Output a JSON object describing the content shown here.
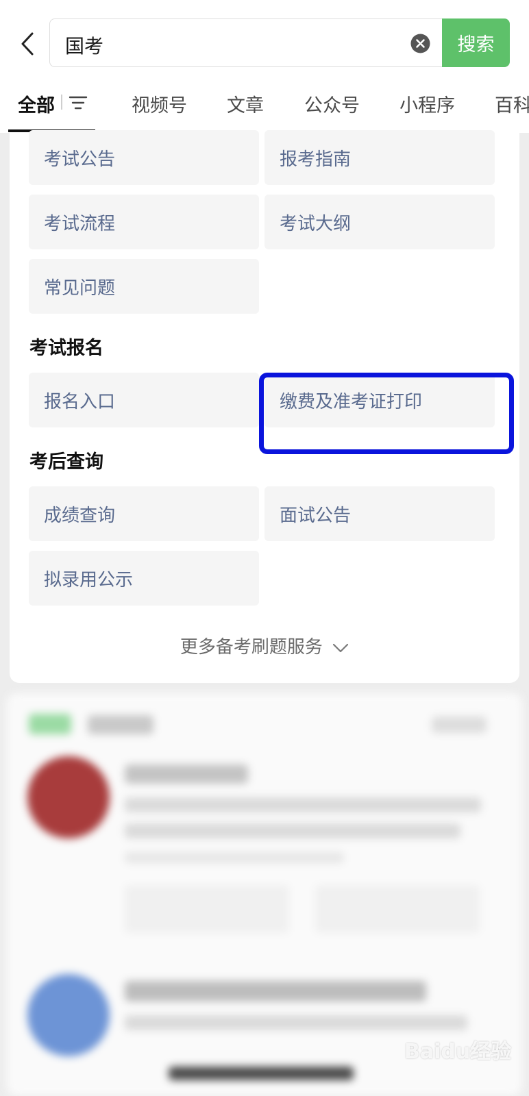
{
  "header": {
    "search_query": "国考",
    "search_button": "搜索"
  },
  "tabs": [
    {
      "label": "全部",
      "active": true
    },
    {
      "label": "视频号"
    },
    {
      "label": "文章"
    },
    {
      "label": "公众号"
    },
    {
      "label": "小程序"
    },
    {
      "label": "百科"
    }
  ],
  "service_card": {
    "items_top": [
      "考试公告",
      "报考指南",
      "考试流程",
      "考试大纲",
      "常见问题"
    ],
    "section_registration": {
      "title": "考试报名",
      "items": [
        "报名入口",
        "缴费及准考证打印"
      ]
    },
    "section_after_exam": {
      "title": "考后查询",
      "items": [
        "成绩查询",
        "面试公告",
        "拟录用公示"
      ]
    },
    "more_label": "更多备考刷题服务"
  },
  "watermark": "Baidu经验",
  "colors": {
    "accent_green": "#5ec16a",
    "highlight_blue": "#0a14dc",
    "cell_text": "#596a8e"
  }
}
